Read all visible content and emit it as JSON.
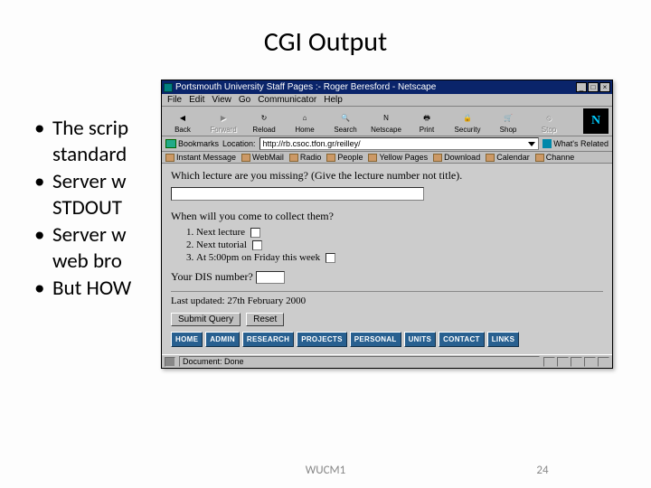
{
  "slide": {
    "title": "CGI Output",
    "bullets": [
      "The scrip",
      "standard",
      "Server w",
      "STDOUT",
      "Server w",
      "web bro",
      "But HOW"
    ],
    "footer_center": "WUCM1",
    "footer_right": "24"
  },
  "netscape": {
    "titlebar": "Portsmouth University Staff Pages :- Roger Beresford - Netscape",
    "window_controls": {
      "min": "_",
      "max": "□",
      "close": "×"
    },
    "menus": [
      "File",
      "Edit",
      "View",
      "Go",
      "Communicator",
      "Help"
    ],
    "toolbar": [
      {
        "label": "Back",
        "glyph": "◀"
      },
      {
        "label": "Forward",
        "glyph": "▶",
        "disabled": true
      },
      {
        "label": "Reload",
        "glyph": "↻"
      },
      {
        "label": "Home",
        "glyph": "⌂"
      },
      {
        "label": "Search",
        "glyph": "🔍"
      },
      {
        "label": "Netscape",
        "glyph": "N"
      },
      {
        "label": "Print",
        "glyph": "🖶"
      },
      {
        "label": "Security",
        "glyph": "🔒"
      },
      {
        "label": "Shop",
        "glyph": "🛒"
      },
      {
        "label": "Stop",
        "glyph": "⦸",
        "disabled": true
      }
    ],
    "bookmarks_label": "Bookmarks",
    "location_label": "Location:",
    "url": "http://rb.csoc.tfon.gr/reilley/",
    "related_label": "What's Related",
    "quicklinks": [
      "Instant Message",
      "WebMail",
      "Radio",
      "People",
      "Yellow Pages",
      "Download",
      "Calendar",
      "Channe"
    ],
    "page": {
      "q1": "Which lecture are you missing? (Give the lecture number not title).",
      "q2": "When will you come to collect them?",
      "options": [
        "Next lecture",
        "Next tutorial",
        "At 5:00pm on Friday this week"
      ],
      "q3_label": "Your DIS number?",
      "updated": "Last updated: 27th February 2000",
      "buttons": {
        "submit": "Submit Query",
        "reset": "Reset"
      },
      "nav": [
        "HOME",
        "ADMIN",
        "RESEARCH",
        "PROJECTS",
        "PERSONAL",
        "UNITS",
        "CONTACT",
        "LINKS"
      ]
    },
    "status": "Document: Done"
  }
}
